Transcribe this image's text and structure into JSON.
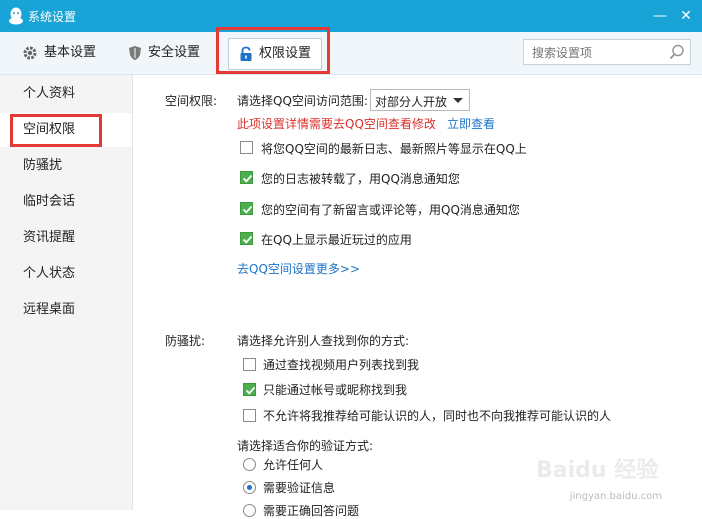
{
  "window": {
    "title": "系统设置",
    "minimize_glyph": "—",
    "close_glyph": "✕"
  },
  "toolbar": {
    "tabs": [
      {
        "label": "基本设置",
        "icon": "gear-icon"
      },
      {
        "label": "安全设置",
        "icon": "shield-icon"
      },
      {
        "label": "权限设置",
        "icon": "lock-icon",
        "active": true
      }
    ],
    "search_placeholder": "搜索设置项"
  },
  "sidebar": {
    "items": [
      {
        "label": "个人资料"
      },
      {
        "label": "空间权限",
        "active": true
      },
      {
        "label": "防骚扰"
      },
      {
        "label": "临时会话"
      },
      {
        "label": "资讯提醒"
      },
      {
        "label": "个人状态"
      },
      {
        "label": "远程桌面"
      }
    ]
  },
  "space": {
    "section_label": "空间权限:",
    "access_prompt": "请选择QQ空间访问范围:",
    "access_value": "对部分人开放",
    "notice": "此项设置详情需要去QQ空间查看修改",
    "view_now": "立即查看",
    "options": [
      {
        "label": "将您QQ空间的最新日志、最新照片等显示在QQ上",
        "checked": false
      },
      {
        "label": "您的日志被转载了，用QQ消息通知您",
        "checked": true
      },
      {
        "label": "您的空间有了新留言或评论等，用QQ消息通知您",
        "checked": true
      },
      {
        "label": "在QQ上显示最近玩过的应用",
        "checked": true
      }
    ],
    "more_link": "去QQ空间设置更多>>"
  },
  "antiharass": {
    "section_label": "防骚扰:",
    "find_prompt": "请选择允许别人查找到你的方式:",
    "find_options": [
      {
        "label": "通过查找视频用户列表找到我",
        "checked": false
      },
      {
        "label": "只能通过帐号或昵称找到我",
        "checked": true
      },
      {
        "label": "不允许将我推荐给可能认识的人，同时也不向我推荐可能认识的人",
        "checked": false
      }
    ],
    "verify_prompt": "请选择适合你的验证方式:",
    "verify_options": [
      {
        "label": "允许任何人",
        "checked": false
      },
      {
        "label": "需要验证信息",
        "checked": true
      },
      {
        "label": "需要正确回答问题",
        "checked": false
      }
    ]
  },
  "watermark": {
    "text": "Baidu 经验",
    "url": "jingyan.baidu.com"
  },
  "colors": {
    "titlebar": "#18a4d6",
    "highlight": "#e53935",
    "check": "#4cae4c",
    "link": "#1e73c8",
    "notice": "#d9312b"
  }
}
